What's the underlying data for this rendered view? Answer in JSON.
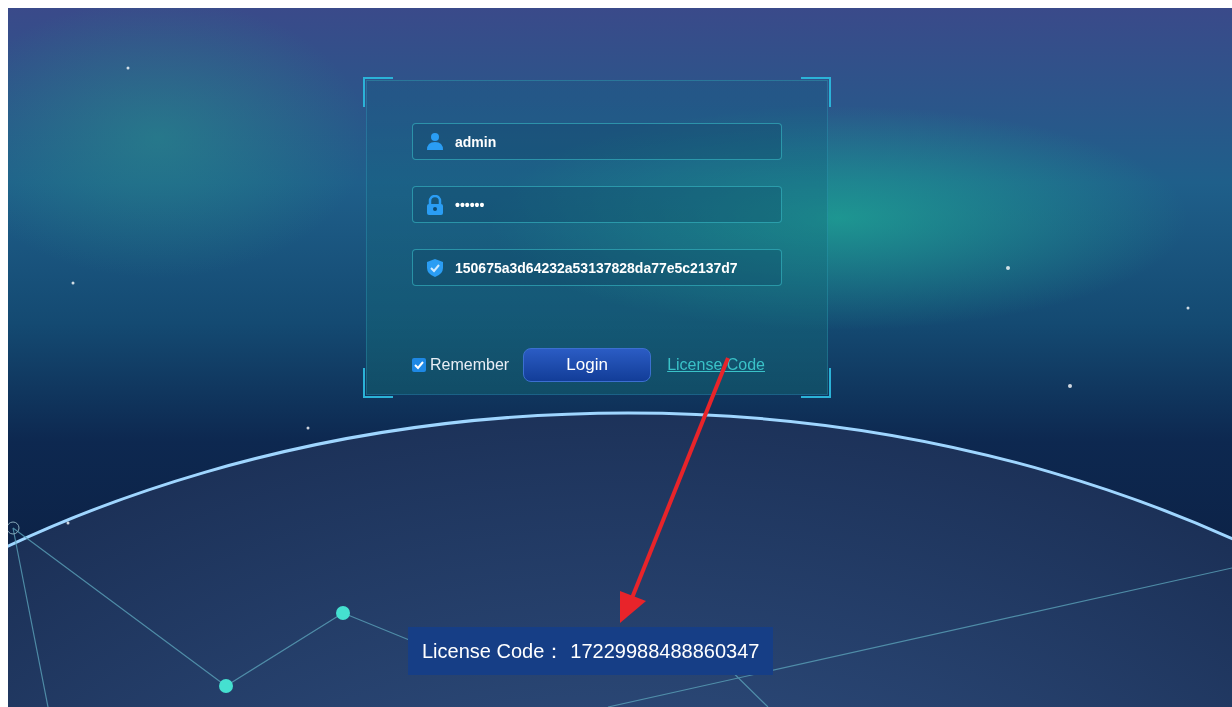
{
  "login_form": {
    "fields": [
      {
        "kind": "user",
        "value": "admin"
      },
      {
        "kind": "password",
        "value": "••••••"
      },
      {
        "kind": "key",
        "value": "150675a3d64232a53137828da77e5c2137d7"
      }
    ],
    "remember": {
      "label": "Remember",
      "checked": true
    },
    "login_button": "Login",
    "license_link": "License Code"
  },
  "license_banner": {
    "label": "License Code：",
    "code": "17229988488860347"
  }
}
